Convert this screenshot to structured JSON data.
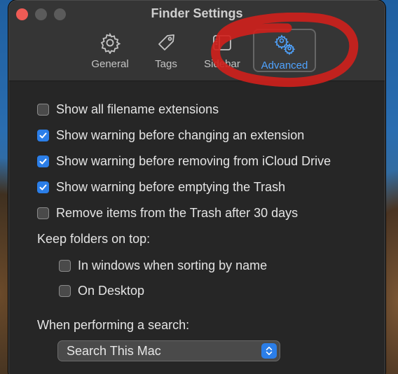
{
  "window": {
    "title": "Finder Settings"
  },
  "tabs": [
    {
      "label": "General",
      "icon": "gear-icon",
      "active": false
    },
    {
      "label": "Tags",
      "icon": "tag-icon",
      "active": false
    },
    {
      "label": "Sidebar",
      "icon": "sidebar-icon",
      "active": false
    },
    {
      "label": "Advanced",
      "icon": "gears-icon",
      "active": true
    }
  ],
  "options": [
    {
      "label": "Show all filename extensions",
      "checked": false
    },
    {
      "label": "Show warning before changing an extension",
      "checked": true
    },
    {
      "label": "Show warning before removing from iCloud Drive",
      "checked": true
    },
    {
      "label": "Show warning before emptying the Trash",
      "checked": true
    },
    {
      "label": "Remove items from the Trash after 30 days",
      "checked": false
    }
  ],
  "keep_folders": {
    "heading": "Keep folders on top:",
    "options": [
      {
        "label": "In windows when sorting by name",
        "checked": false
      },
      {
        "label": "On Desktop",
        "checked": false
      }
    ]
  },
  "search": {
    "heading": "When performing a search:",
    "selected": "Search This Mac"
  },
  "colors": {
    "accent": "#2b7ee8",
    "active_tab_text": "#4fa3ff",
    "annotation_red": "#d0201c"
  }
}
